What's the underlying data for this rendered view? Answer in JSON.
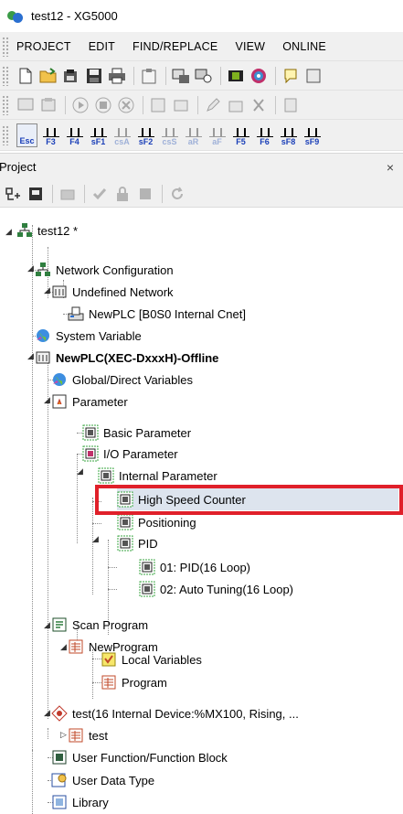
{
  "window": {
    "title": "test12 - XG5000"
  },
  "menu": [
    "PROJECT",
    "EDIT",
    "FIND/REPLACE",
    "VIEW",
    "ONLINE"
  ],
  "toolbar1": [
    "new-project-icon",
    "open-project-icon",
    "open-folder-icon",
    "save-icon",
    "print-icon",
    "clipboard-icon",
    "plc-connect-icon",
    "plc-monitor-icon",
    "film-icon",
    "disc-icon",
    "lightbulb-icon",
    "help-icon"
  ],
  "toolbar2": [
    "screen-icon",
    "module-icon",
    "run-icon",
    "stop-icon",
    "cancel-icon",
    "network-icon",
    "folder-icon",
    "pen-icon",
    "package-icon",
    "cut-icon",
    "page-icon"
  ],
  "fkeys": [
    "Esc",
    "F3",
    "F4",
    "sF1",
    "csA",
    "sF2",
    "csS",
    "aR",
    "aF",
    "F5",
    "F6",
    "sF8",
    "sF9"
  ],
  "project_pane": {
    "title": "Project",
    "close": "×"
  },
  "tree": {
    "root": "test12 *",
    "network_configuration": "Network Configuration",
    "undefined_network": "Undefined Network",
    "newplc_cnet": "NewPLC [B0S0 Internal Cnet]",
    "system_variable": "System Variable",
    "plc": "NewPLC(XEC-DxxxH)-Offline",
    "global_variables": "Global/Direct Variables",
    "parameter": "Parameter",
    "basic_parameter": "Basic Parameter",
    "io_parameter": "I/O Parameter",
    "internal_parameter": "Internal Parameter",
    "high_speed_counter": "High Speed Counter",
    "positioning": "Positioning",
    "pid": "PID",
    "pid_16_loop": "01: PID(16 Loop)",
    "auto_tuning": "02: Auto Tuning(16 Loop)",
    "scan_program": "Scan Program",
    "new_program": "NewProgram",
    "local_variables": "Local Variables",
    "program": "Program",
    "test_task": "test(16 Internal Device:%MX100, Rising, ...",
    "test": "test",
    "user_function": "User Function/Function Block",
    "user_data_type": "User Data Type",
    "library": "Library"
  },
  "colors": {
    "highlight": "#e0202a",
    "selection": "#dde4ee",
    "fkey_label": "#1a3fb8"
  }
}
